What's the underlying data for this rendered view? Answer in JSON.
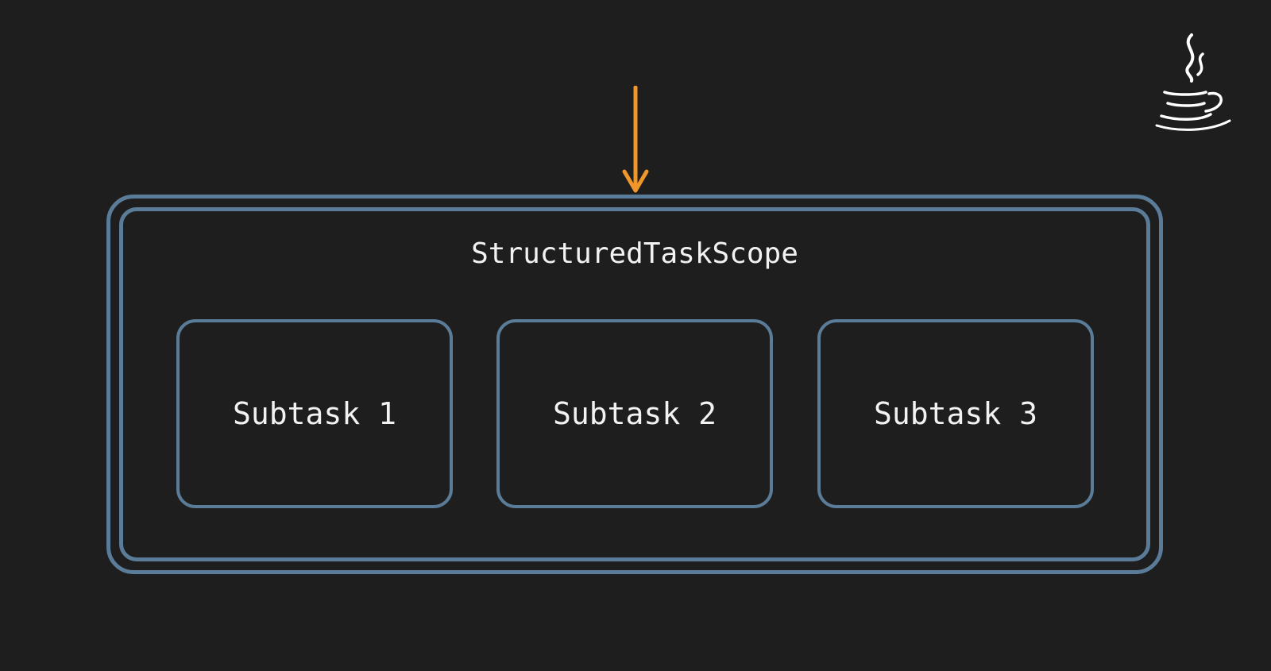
{
  "scope": {
    "title": "StructuredTaskScope"
  },
  "subtasks": [
    {
      "label": "Subtask 1"
    },
    {
      "label": "Subtask 2"
    },
    {
      "label": "Subtask 3"
    }
  ],
  "colors": {
    "background": "#1e1e1e",
    "box_border": "#5b7c99",
    "arrow": "#f0962a",
    "text": "#f2f2f2"
  },
  "icons": {
    "logo": "java-coffee-cup-icon",
    "arrow": "arrow-down-icon"
  }
}
